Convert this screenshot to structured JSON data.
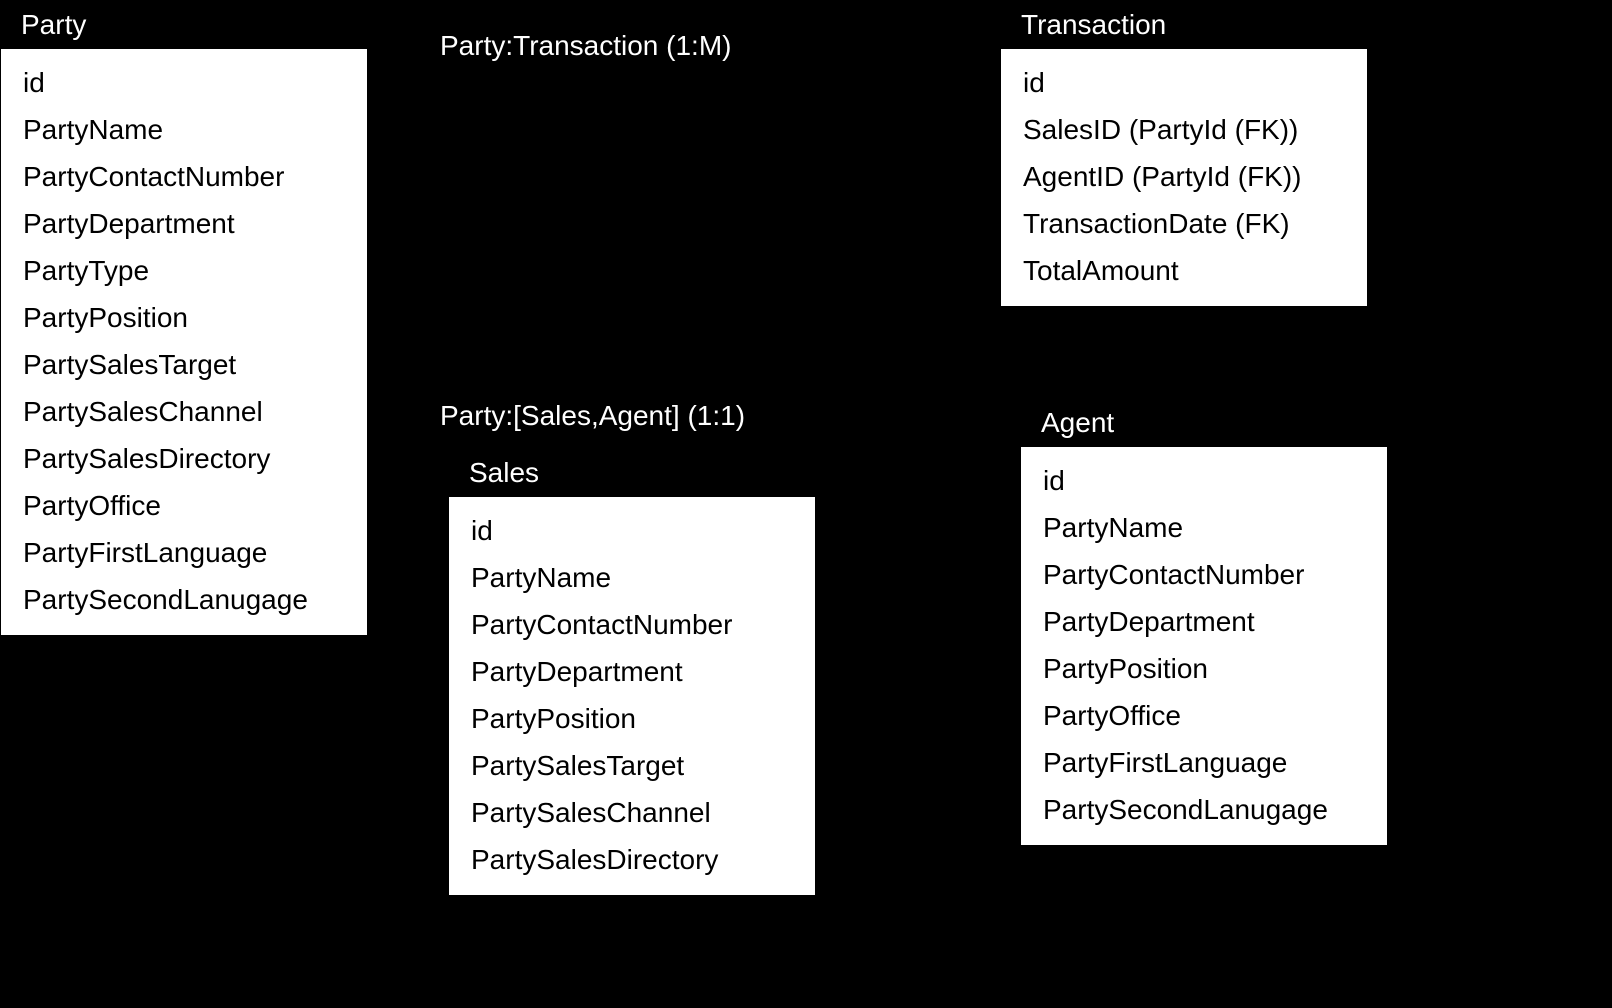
{
  "entities": {
    "party": {
      "title": "Party",
      "attributes": [
        "id",
        "PartyName",
        "PartyContactNumber",
        "PartyDepartment",
        "PartyType",
        "PartyPosition",
        "PartySalesTarget",
        "PartySalesChannel",
        "PartySalesDirectory",
        "PartyOffice",
        "PartyFirstLanguage",
        "PartySecondLanugage"
      ]
    },
    "transaction": {
      "title": "Transaction",
      "attributes": [
        "id",
        "SalesID (PartyId (FK))",
        "AgentID (PartyId (FK))",
        "TransactionDate (FK)",
        "TotalAmount"
      ]
    },
    "sales": {
      "title": "Sales",
      "attributes": [
        "id",
        "PartyName",
        "PartyContactNumber",
        "PartyDepartment",
        "PartyPosition",
        "PartySalesTarget",
        "PartySalesChannel",
        "PartySalesDirectory"
      ]
    },
    "agent": {
      "title": "Agent",
      "attributes": [
        "id",
        "PartyName",
        "PartyContactNumber",
        "PartyDepartment",
        "PartyPosition",
        "PartyOffice",
        "PartyFirstLanguage",
        "PartySecondLanugage"
      ]
    }
  },
  "labels": {
    "party_to_transaction": "Party:Transaction (1:M)",
    "party_to_sales_agent": "Party:[Sales,Agent] (1:1)"
  }
}
